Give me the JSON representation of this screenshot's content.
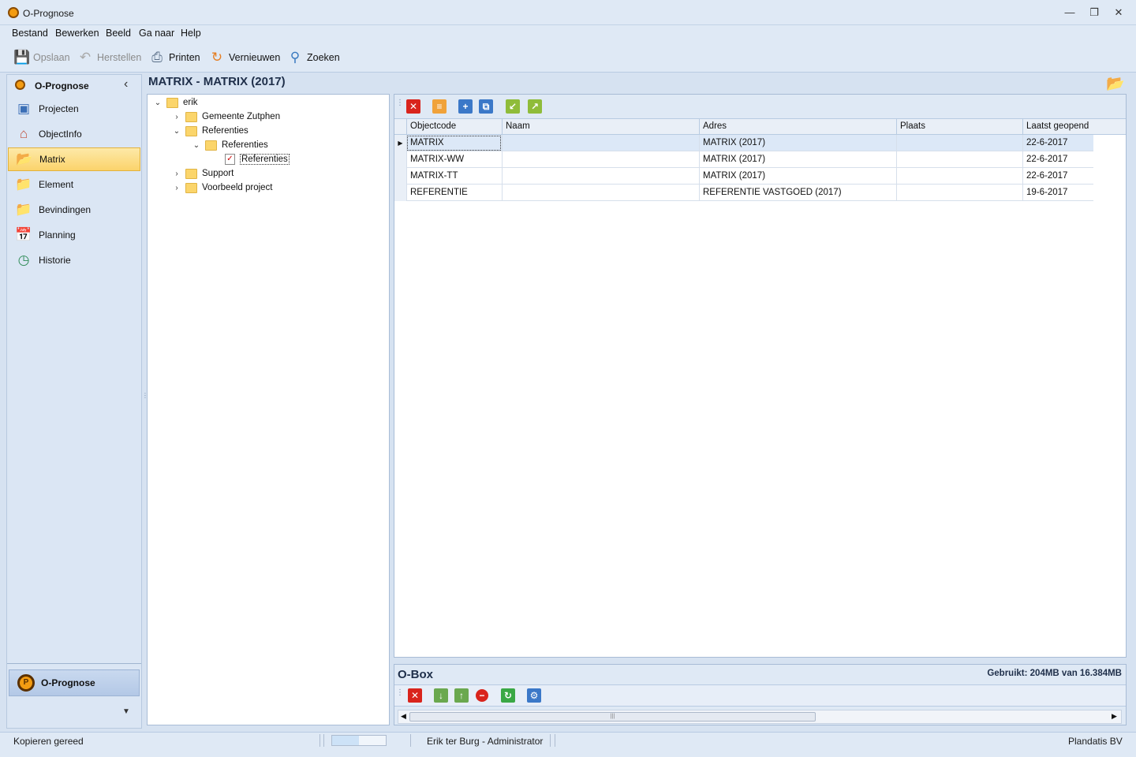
{
  "window": {
    "title": "O-Prognose",
    "controls": [
      "minimize",
      "restore",
      "close"
    ]
  },
  "menu": [
    "Bestand",
    "Bewerken",
    "Beeld",
    "Ga naar",
    "Help"
  ],
  "toolbar": {
    "save": "Opslaan",
    "restore": "Herstellen",
    "print": "Printen",
    "refresh": "Vernieuwen",
    "search": "Zoeken"
  },
  "nav": {
    "title": "O-Prognose",
    "items": [
      "Projecten",
      "ObjectInfo",
      "Matrix",
      "Element",
      "Bevindingen",
      "Planning",
      "Historie"
    ],
    "selected": "Matrix",
    "bottom": "O-Prognose"
  },
  "page_title": "MATRIX - MATRIX (2017)",
  "tree": {
    "root": "erik",
    "nodes": [
      "Gemeente Zutphen",
      "Referenties",
      "Referenties",
      "Referenties",
      "Support",
      "Voorbeeld project"
    ]
  },
  "grid": {
    "columns": [
      "Objectcode",
      "Naam",
      "Adres",
      "Plaats",
      "Laatst geopend"
    ],
    "rows": [
      [
        "MATRIX",
        "",
        "MATRIX (2017)",
        "",
        "22-6-2017"
      ],
      [
        "MATRIX-WW",
        "",
        "MATRIX (2017)",
        "",
        "22-6-2017"
      ],
      [
        "MATRIX-TT",
        "",
        "MATRIX (2017)",
        "",
        "22-6-2017"
      ],
      [
        "REFERENTIE",
        "",
        "REFERENTIE VASTGOED (2017)",
        "",
        "19-6-2017"
      ]
    ]
  },
  "obox": {
    "title": "O-Box",
    "usage": "Gebruikt: 204MB van 16.384MB"
  },
  "status": {
    "left": "Kopieren gereed",
    "user": "Erik ter Burg - Administrator",
    "company": "Plandatis BV"
  },
  "colors": {
    "accent": "#f39c12",
    "selected_nav": "#fbd36b",
    "panel": "#dfe9f5"
  }
}
